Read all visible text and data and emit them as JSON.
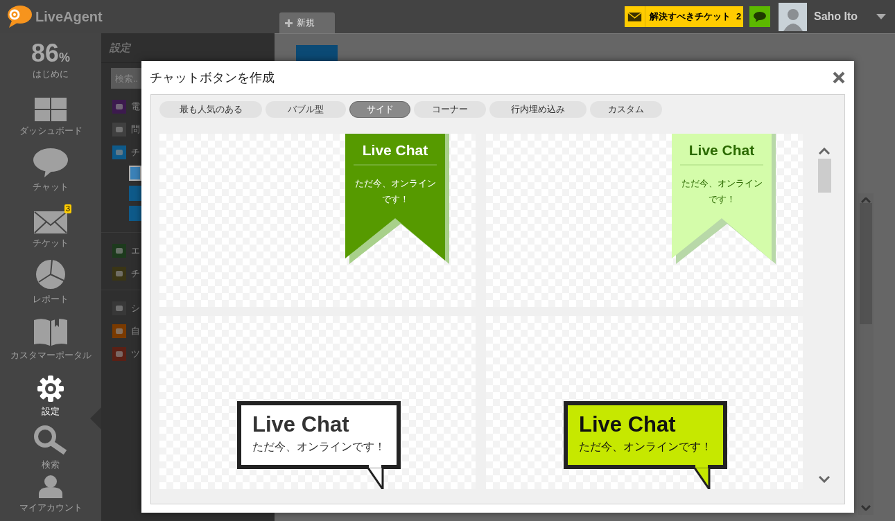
{
  "header": {
    "logo": "LiveAgent",
    "new_tab": "新規",
    "tickets_button": {
      "label": "解決すべきチケット",
      "count": "2"
    },
    "user": {
      "name": "Saho Ito"
    }
  },
  "sidebar": {
    "progress": {
      "value": "86",
      "unit": "%",
      "label": "はじめに"
    },
    "items": [
      {
        "label": "ダッシュボード",
        "selected": false
      },
      {
        "label": "チャット",
        "selected": false
      },
      {
        "label": "チケット",
        "selected": false,
        "badge": "3"
      },
      {
        "label": "レポート",
        "selected": false
      },
      {
        "label": "カスタマーポータル",
        "selected": false
      },
      {
        "label": "設定",
        "selected": true
      },
      {
        "label": "検索",
        "selected": false
      },
      {
        "label": "マイアカウント",
        "selected": false
      }
    ]
  },
  "settings_panel": {
    "title": "設定",
    "search": {
      "placeholder": "検索.."
    },
    "groups": [
      [
        {
          "label": "電",
          "color": "#3c1a4e"
        },
        {
          "label": "問",
          "color": "#404040"
        },
        {
          "label": "チ",
          "color": "#0e5a8a",
          "children": [
            {
              "selected": true
            },
            {
              "selected": false
            },
            {
              "selected": false
            }
          ]
        }
      ],
      [
        {
          "label": "エ",
          "color": "#1d3a1d"
        },
        {
          "label": "チ",
          "color": "#3a3515"
        }
      ],
      [
        {
          "label": "シ",
          "color": "#383838"
        },
        {
          "label": "自",
          "color": "#7a3a00"
        },
        {
          "label": "ツ",
          "color": "#5a2015"
        }
      ]
    ]
  },
  "modal": {
    "title": "チャットボタンを作成",
    "tabs": [
      {
        "label": "最も人気のある",
        "selected": false
      },
      {
        "label": "バブル型",
        "selected": false
      },
      {
        "label": "サイド",
        "selected": true
      },
      {
        "label": "コーナー",
        "selected": false
      },
      {
        "label": "行内埋め込み",
        "selected": false
      },
      {
        "label": "カスタム",
        "selected": false
      }
    ],
    "previews": [
      {
        "kind": "ribbon",
        "color": "#569a00",
        "title": "Live Chat",
        "text": "ただ今、オンラインです！"
      },
      {
        "kind": "ribbon",
        "color": "#d4fcaa",
        "title": "Live Chat",
        "text": "ただ今、オンラインです！"
      },
      {
        "kind": "bubble",
        "color": "#ffffff",
        "title": "Live Chat",
        "text": "ただ今、オンラインです！"
      },
      {
        "kind": "bubble",
        "color": "#c6e800",
        "title": "Live Chat",
        "text": "ただ今、オンラインです！"
      }
    ]
  }
}
